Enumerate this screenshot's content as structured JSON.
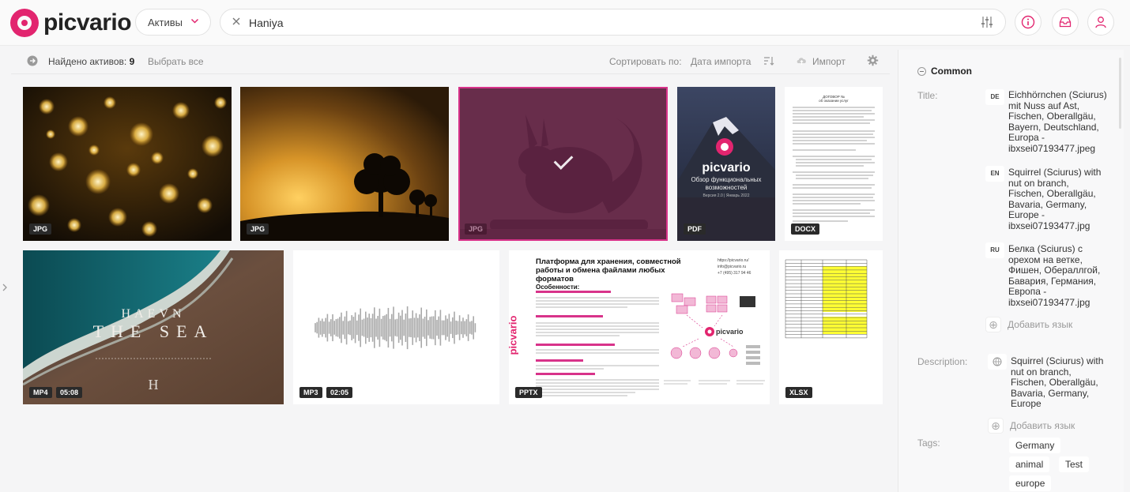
{
  "brand": {
    "name": "picvario",
    "accent": "#e2256f"
  },
  "header": {
    "assets_select": "Активы",
    "search_value": "Haniya"
  },
  "toolbar": {
    "found_label": "Найдено активов:",
    "found_count": "9",
    "select_all": "Выбрать все",
    "sort_label": "Сортировать по:",
    "sort_value": "Дата импорта",
    "import": "Импорт"
  },
  "assets": [
    {
      "type": "JPG",
      "subject": "bokeh lights"
    },
    {
      "type": "JPG",
      "subject": "tree at sunset"
    },
    {
      "type": "JPG",
      "subject": "squirrel",
      "selected": true
    },
    {
      "type": "PDF",
      "subject": "picvario brochure",
      "logo": "picvario",
      "line1": "Обзор функциональных",
      "line2": "возможностей",
      "meta": "Версия 2.0 | Январь 2022"
    },
    {
      "type": "DOCX",
      "subject": "document",
      "doc_title": "ДОГОВОР №",
      "doc_sub": "об оказании услуг"
    },
    {
      "type": "MP4",
      "duration": "05:08",
      "subject": "sea video",
      "title1": "HAEVN",
      "title2": "THE SEA",
      "mark": "H"
    },
    {
      "type": "MP3",
      "duration": "02:05",
      "subject": "audio waveform"
    },
    {
      "type": "PPTX",
      "subject": "presentation",
      "slide_title_1": "Платформа для хранения, совместной",
      "slide_title_2": "работы и обмена файлами любых",
      "slide_title_3": "форматов",
      "contact_site": "https://picvario.ru/",
      "contact_mail": "info@picvario.ru",
      "contact_phone": "+7 (495) 317 94 46",
      "features_heading": "Особенности:",
      "logo": "picvario"
    },
    {
      "type": "XLSX",
      "subject": "spreadsheet"
    }
  ],
  "panel": {
    "section": "Common",
    "title_label": "Title:",
    "titles": [
      {
        "lang": "DE",
        "text": "Eichhörnchen (Sciurus) mit Nuss auf Ast, Fischen, Oberallgäu, Bayern, Deutschland, Europa - ibxsei07193477.jpeg"
      },
      {
        "lang": "EN",
        "text": "Squirrel (Sciurus) with nut on branch, Fischen, Oberallgäu, Bavaria, Germany, Europe - ibxsei07193477.jpg"
      },
      {
        "lang": "RU",
        "text": "Белка (Sciurus) с орехом на ветке, Фишен, Обераллгой, Бавария, Германия, Европа - ibxsei07193477.jpg"
      }
    ],
    "add_language": "Добавить язык",
    "description_label": "Description:",
    "description": "Squirrel (Sciurus) with nut on branch, Fischen, Oberallgäu, Bavaria, Germany, Europe",
    "tags_label": "Tags:",
    "tags": [
      "Germany",
      "animal",
      "Test",
      "europe"
    ]
  }
}
